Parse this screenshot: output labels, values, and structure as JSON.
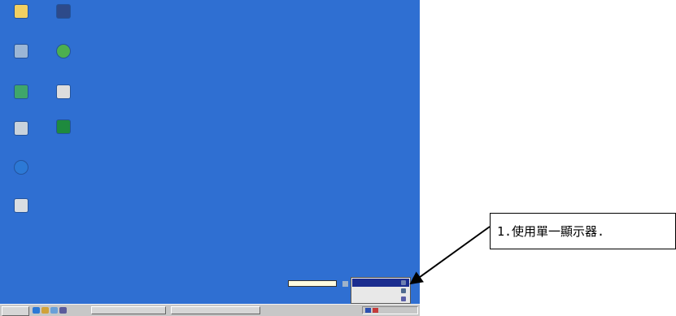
{
  "desktop": {
    "background_color": "#2f6fd2",
    "icons": [
      {
        "name": "folder-icon",
        "color": "#f2d062"
      },
      {
        "name": "media-player-icon",
        "color": "#2d4a8a"
      },
      {
        "name": "computer-icon",
        "color": "#9bb6d6"
      },
      {
        "name": "messenger-icon",
        "color": "#4caf50"
      },
      {
        "name": "network-icon",
        "color": "#3fa66b"
      },
      {
        "name": "notepad-icon",
        "color": "#dddddd"
      },
      {
        "name": "recycle-bin-icon",
        "color": "#c8d2dc"
      },
      {
        "name": "chart-icon",
        "color": "#1e8a3e"
      },
      {
        "name": "internet-explorer-icon",
        "color": "#2c79d6"
      },
      {
        "name": "outlook-express-icon",
        "color": "#d9dde2"
      }
    ]
  },
  "taskbar": {
    "quick_launch": [
      {
        "name": "ie-quick-icon",
        "color": "#2c79d6"
      },
      {
        "name": "outlook-quick-icon",
        "color": "#d1a23a"
      },
      {
        "name": "desktop-quick-icon",
        "color": "#6aa0d8"
      },
      {
        "name": "media-quick-icon",
        "color": "#5b5b9b"
      }
    ]
  },
  "tray_menu": {
    "items": [
      {
        "name": "menu-item-1",
        "icon": "display-icon",
        "color": "#6d7fb0",
        "selected": true
      },
      {
        "name": "menu-item-2",
        "icon": "monitor-icon",
        "color": "#4f6a8f",
        "selected": false
      },
      {
        "name": "menu-item-3",
        "icon": "settings-icon",
        "color": "#5a5fa8",
        "selected": false
      }
    ]
  },
  "annotation": {
    "text": "1.使用單一顯示器.",
    "arrow_color": "#000000"
  }
}
